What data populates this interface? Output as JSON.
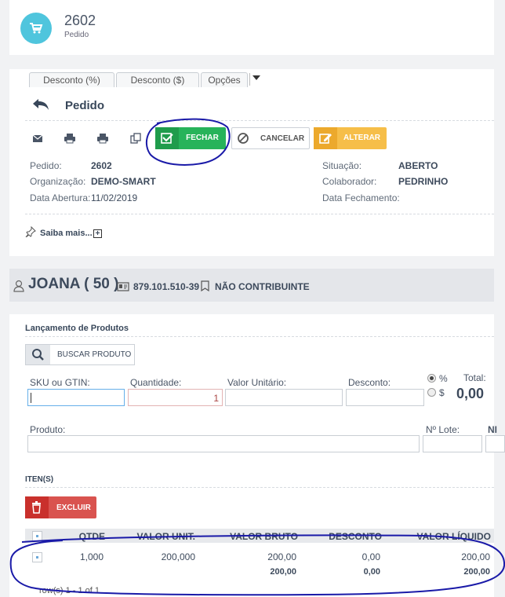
{
  "header": {
    "number": "2602",
    "subtitle": "Pedido"
  },
  "tabs": [
    {
      "label": "Desconto (%)"
    },
    {
      "label": "Desconto ($)"
    },
    {
      "label": "Opções"
    }
  ],
  "section": {
    "title": "Pedido"
  },
  "actions": {
    "fechar": "FECHAR",
    "cancelar": "CANCELAR",
    "alterar": "ALTERAR"
  },
  "info": {
    "pedido_label": "Pedido:",
    "pedido_value": "2602",
    "org_label": "Organização:",
    "org_value": "DEMO-SMART",
    "abertura_label": "Data Abertura:",
    "abertura_value": "11/02/2019",
    "situacao_label": "Situação:",
    "situacao_value": "ABERTO",
    "colab_label": "Colaborador:",
    "colab_value": "PEDRINHO",
    "fechamento_label": "Data Fechamento:",
    "fechamento_value": ""
  },
  "saiba_mais": "Saiba mais...",
  "customer": {
    "name": "JOANA ( 50 )",
    "document": "879.101.510-39",
    "tax_status": "NÃO CONTRIBUINTE"
  },
  "products": {
    "title": "Lançamento de Produtos",
    "search_button": "BUSCAR PRODUTO",
    "sku_label": "SKU ou GTIN:",
    "qty_label": "Quantidade:",
    "qty_value": "1",
    "unit_label": "Valor Unitário:",
    "discount_label": "Desconto:",
    "pct_symbol": "%",
    "cur_symbol": "$",
    "total_label": "Total:",
    "total_value": "0,00",
    "product_label": "Produto:",
    "lote_label": "Nº Lote:",
    "extra_label": "NI"
  },
  "items": {
    "title": "ITEN(S)",
    "delete_button": "EXCLUIR",
    "headers": [
      "QTDE",
      "VALOR UNIT.",
      "VALOR BRUTO",
      "DESCONTO",
      "VALOR LÍQUIDO"
    ],
    "rows": [
      {
        "qtde": "1,000",
        "valor_unit": "200,000",
        "valor_bruto": "200,00",
        "desconto": "0,00",
        "valor_liquido": "200,00"
      }
    ],
    "totals": {
      "valor_bruto": "200,00",
      "desconto": "0,00",
      "valor_liquido": "200,00"
    },
    "pager": "row(s) 1 - 1 of 1"
  },
  "colors": {
    "accent_cyan": "#4fc5dd",
    "success": "#27b35a",
    "warning": "#f6be49",
    "danger": "#d9534f",
    "annotation": "#1a1aa8"
  }
}
